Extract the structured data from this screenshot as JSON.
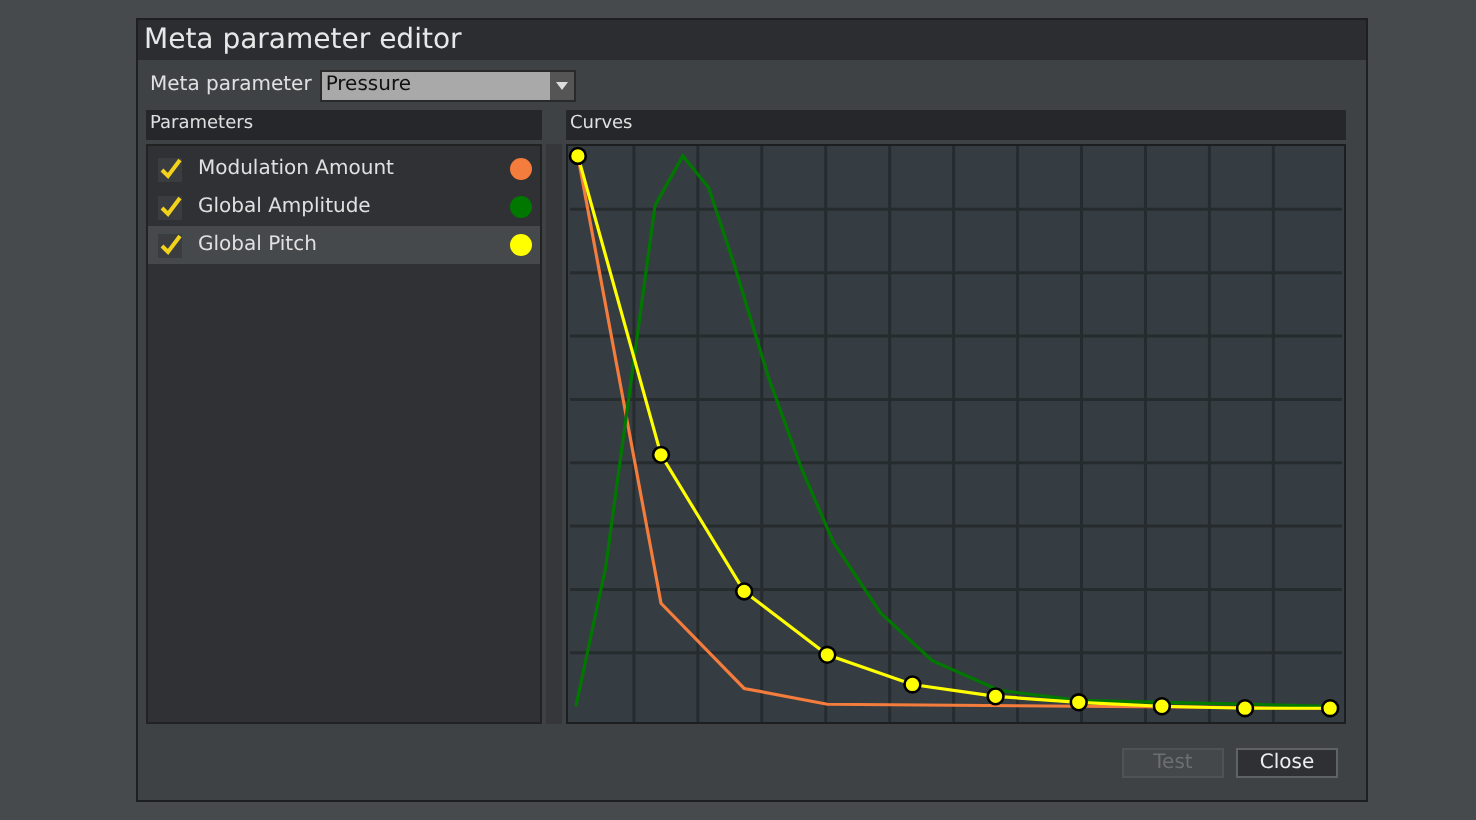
{
  "window": {
    "title": "Meta parameter editor"
  },
  "meta_parameter": {
    "label": "Meta parameter",
    "value": "Pressure"
  },
  "parameters": {
    "header": "Parameters",
    "items": [
      {
        "label": "Modulation Amount",
        "checked": true,
        "selected": false,
        "color": "#f47c3c"
      },
      {
        "label": "Global Amplitude",
        "checked": true,
        "selected": false,
        "color": "#007800"
      },
      {
        "label": "Global Pitch",
        "checked": true,
        "selected": true,
        "color": "#ffff00"
      }
    ]
  },
  "curves": {
    "header": "Curves"
  },
  "buttons": [
    {
      "label": "Test",
      "disabled": true
    },
    {
      "label": "Close",
      "disabled": false
    }
  ]
}
